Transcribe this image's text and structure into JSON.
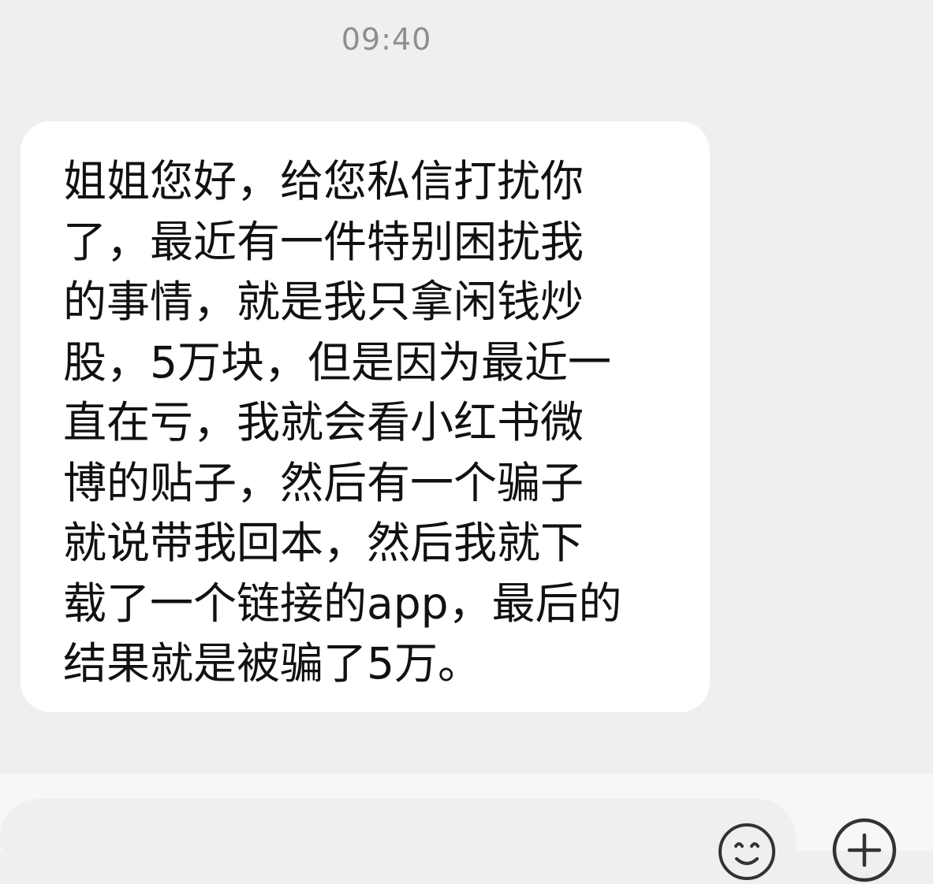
{
  "chat": {
    "timestamp": "09:40",
    "messages": [
      {
        "side": "incoming",
        "text": "姐姐您好，给您私信打扰你\n了，最近有一件特别困扰我\n的事情，就是我只拿闲钱炒\n股，5万块，但是因为最近一\n直在亏，我就会看小红书微\n博的贴子，然后有一个骗子\n就说带我回本，然后我就下\n载了一个链接的app，最后的\n结果就是被骗了5万。"
      }
    ]
  },
  "input_bar": {
    "input_value": "",
    "icons": [
      "emoji-icon",
      "plus-icon"
    ]
  },
  "colors": {
    "background": "#efefef",
    "bubble": "#ffffff",
    "text": "#111111",
    "timestamp": "#8e8e8e"
  }
}
